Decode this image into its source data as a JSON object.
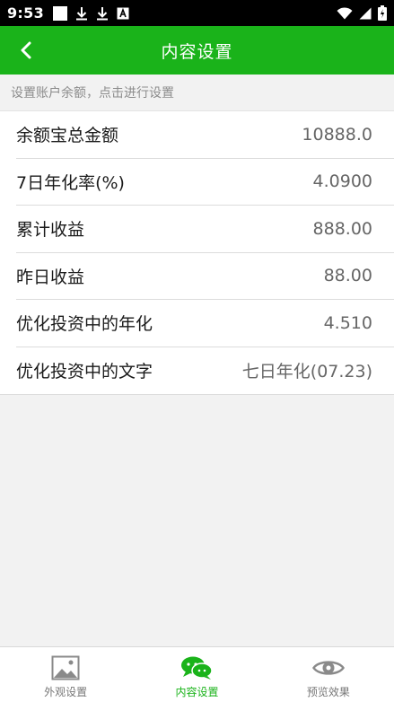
{
  "status_bar": {
    "time": "9:53"
  },
  "header": {
    "title": "内容设置"
  },
  "hint": "设置账户余额，点击进行设置",
  "rows": [
    {
      "label": "余额宝总金额",
      "value": "10888.0"
    },
    {
      "label": "7日年化率(%)",
      "value": "4.0900"
    },
    {
      "label": "累计收益",
      "value": "888.00"
    },
    {
      "label": "昨日收益",
      "value": "88.00"
    },
    {
      "label": "优化投资中的年化",
      "value": "4.510"
    },
    {
      "label": "优化投资中的文字",
      "value": "七日年化(07.23)"
    }
  ],
  "tabs": [
    {
      "label": "外观设置",
      "icon": "image-icon",
      "active": false
    },
    {
      "label": "内容设置",
      "icon": "chat-bubbles-icon",
      "active": true
    },
    {
      "label": "预览效果",
      "icon": "eye-icon",
      "active": false
    }
  ],
  "colors": {
    "accent": "#1ab31a",
    "background": "#f2f2f2",
    "status_bar": "#000000"
  }
}
